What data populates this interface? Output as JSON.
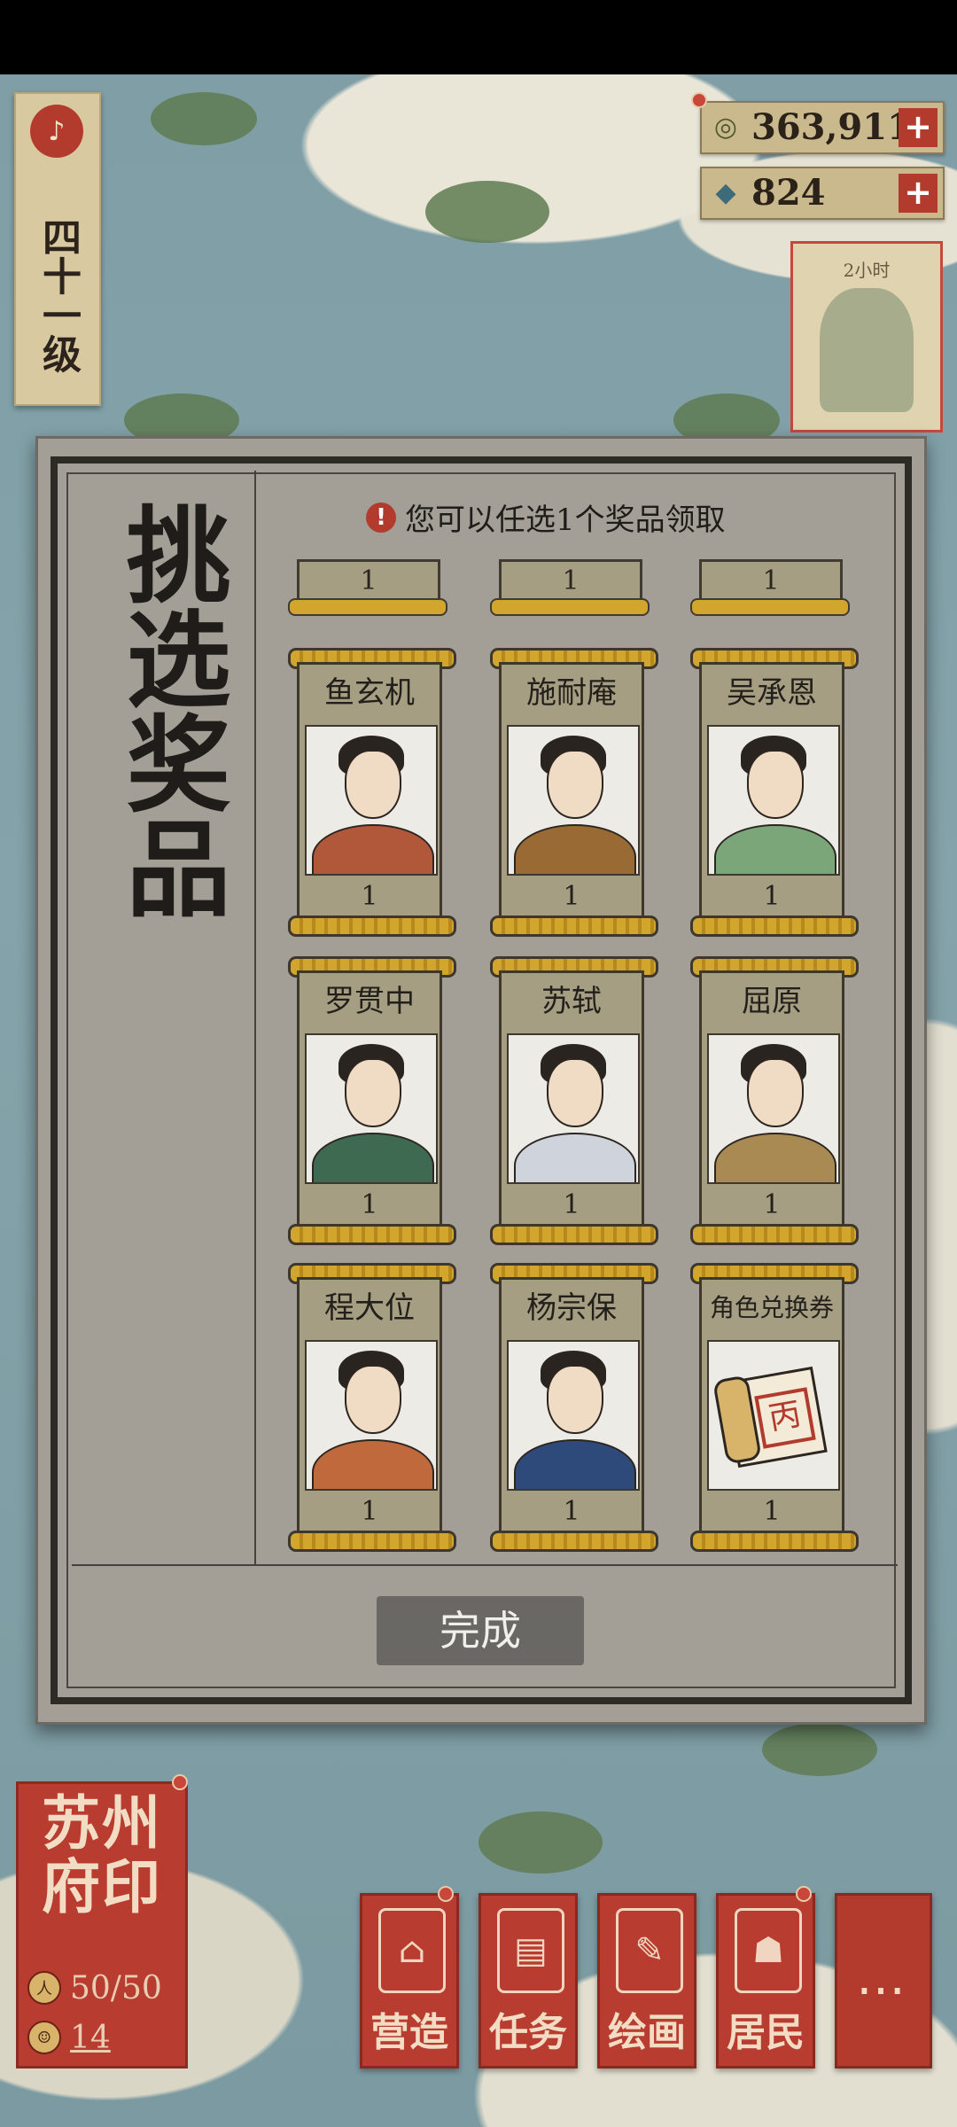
{
  "level": {
    "label": "四十一级",
    "seal_icon": "lute-icon"
  },
  "currencies": [
    {
      "icon": "copper-coin-icon",
      "value": "363,911",
      "plus": "+"
    },
    {
      "icon": "jade-gem-icon",
      "value": "824",
      "plus": "+"
    }
  ],
  "timer_card": {
    "label": "2小时"
  },
  "dialog": {
    "title": "挑选奖品",
    "notice": "您可以任选1个奖品领取",
    "notice_icon": "!",
    "top_counts": [
      "1",
      "1",
      "1"
    ],
    "prizes": [
      {
        "name": "鱼玄机",
        "qty": "1",
        "robe_color": "#b2583a"
      },
      {
        "name": "施耐庵",
        "qty": "1",
        "robe_color": "#9a6a34"
      },
      {
        "name": "吴承恩",
        "qty": "1",
        "robe_color": "#7aa67a"
      },
      {
        "name": "罗贯中",
        "qty": "1",
        "robe_color": "#3f6a52"
      },
      {
        "name": "苏轼",
        "qty": "1",
        "robe_color": "#cfd3dc"
      },
      {
        "name": "屈原",
        "qty": "1",
        "robe_color": "#a88a52"
      },
      {
        "name": "程大位",
        "qty": "1",
        "robe_color": "#c0693c"
      },
      {
        "name": "杨宗保",
        "qty": "1",
        "robe_color": "#2e4a7a"
      },
      {
        "name": "角色兑换券",
        "qty": "1",
        "robe_color": "#d8b36a"
      }
    ],
    "done_button": "完成"
  },
  "seal": {
    "title": "苏州府印",
    "population": "50/50",
    "count": "14"
  },
  "bottom_nav": [
    {
      "label": "营造",
      "icon": "pavilion-icon"
    },
    {
      "label": "任务",
      "icon": "book-icon"
    },
    {
      "label": "绘画",
      "icon": "scroll-icon"
    },
    {
      "label": "居民",
      "icon": "resident-icon"
    },
    {
      "label": "…",
      "icon": "more-icon"
    }
  ]
}
